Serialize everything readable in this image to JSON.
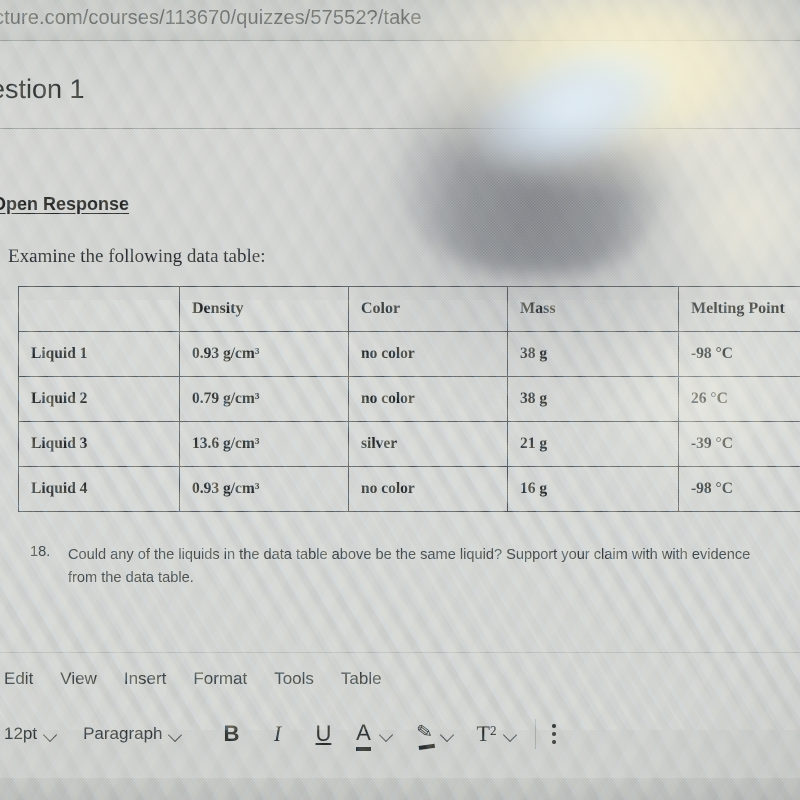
{
  "browser": {
    "url_text": "cture.com/courses/113670/quizzes/57552?/take"
  },
  "quiz": {
    "question_heading": "estion 1",
    "section_label": "Open Response",
    "instruction": "Examine the following data table:"
  },
  "table": {
    "headers": [
      "",
      "Density",
      "Color",
      "Mass",
      "Melting Point"
    ],
    "rows": [
      [
        "Liquid 1",
        "0.93 g/cm³",
        "no color",
        "38 g",
        "-98 °C"
      ],
      [
        "Liquid 2",
        "0.79 g/cm³",
        "no color",
        "38 g",
        "26 °C"
      ],
      [
        "Liquid 3",
        "13.6 g/cm³",
        "silver",
        "21 g",
        "-39 °C"
      ],
      [
        "Liquid 4",
        "0.93 g/cm³",
        "no color",
        "16 g",
        "-98 °C"
      ]
    ]
  },
  "prompt": {
    "number": "18.",
    "text": "Could any of the liquids in the data table above be the same liquid? Support your claim with with evidence from the data table."
  },
  "editor": {
    "menu": [
      {
        "label": "Edit"
      },
      {
        "label": "View"
      },
      {
        "label": "Insert"
      },
      {
        "label": "Format"
      },
      {
        "label": "Tools"
      },
      {
        "label": "Table"
      }
    ],
    "font_size": "12pt",
    "block_format": "Paragraph",
    "buttons": {
      "bold": "B",
      "italic": "I",
      "underline": "U",
      "text_color": "A",
      "highlight": "✎",
      "superscript": "T²"
    }
  }
}
